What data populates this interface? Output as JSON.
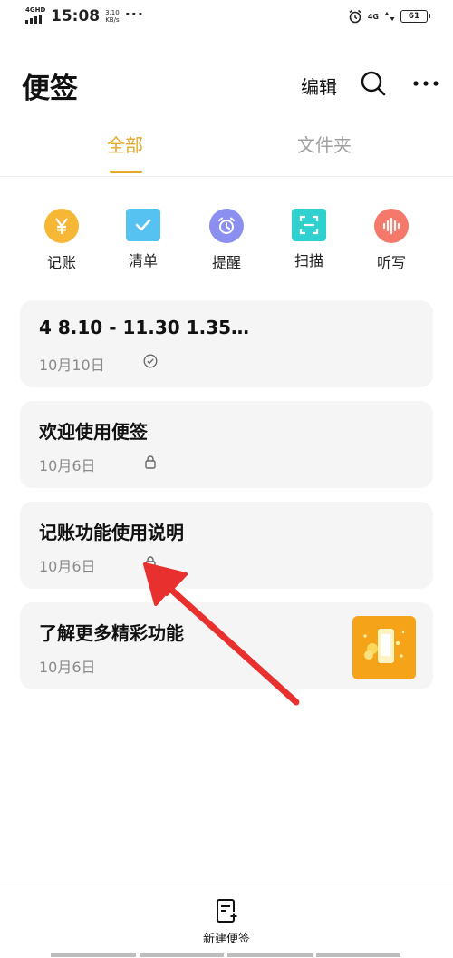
{
  "status_bar": {
    "network_label": "4GHD",
    "time": "15:08",
    "speed_value": "3.10",
    "speed_unit": "KB/s",
    "more_dots": "···",
    "signal_label": "4G",
    "battery": "61"
  },
  "header": {
    "title": "便签",
    "edit_label": "编辑"
  },
  "tabs": [
    {
      "label": "全部",
      "active": true
    },
    {
      "label": "文件夹",
      "active": false
    }
  ],
  "quick_actions": [
    {
      "label": "记账",
      "icon": "yen-icon",
      "color": "#f6b736",
      "glyph": "¥"
    },
    {
      "label": "清单",
      "icon": "checklist-icon",
      "color": "#56c2f2"
    },
    {
      "label": "提醒",
      "icon": "alarm-clock-icon",
      "color": "#8a8ff0"
    },
    {
      "label": "扫描",
      "icon": "scan-icon",
      "color": "#2fd1cf"
    },
    {
      "label": "听写",
      "icon": "voice-wave-icon",
      "color": "#f4796b"
    }
  ],
  "notes": [
    {
      "title": "4  8.10 - 11.30   1.35…",
      "date": "10月10日",
      "status_icon": "check-circle-icon"
    },
    {
      "title": "欢迎使用便签",
      "date": "10月6日",
      "status_icon": "lock-icon"
    },
    {
      "title": "记账功能使用说明",
      "date": "10月6日",
      "status_icon": "lock-icon"
    },
    {
      "title": "了解更多精彩功能",
      "date": "10月6日",
      "thumbnail_icon": "promo-thumbnail"
    }
  ],
  "bottom_bar": {
    "new_note_label": "新建便签"
  },
  "colors": {
    "accent": "#e3a92a",
    "annotation_arrow": "#e8312f"
  }
}
